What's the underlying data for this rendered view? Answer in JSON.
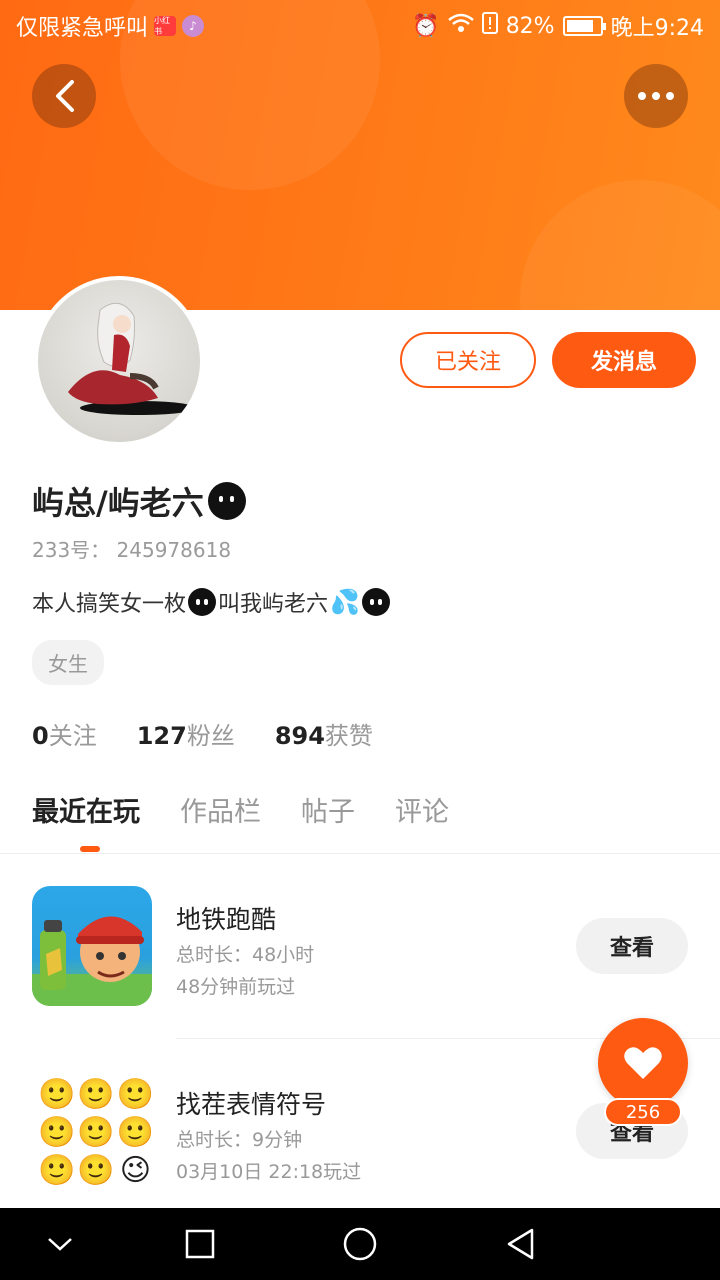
{
  "status_bar": {
    "carrier_text": "仅限紧急呼叫",
    "badge_app": "小红书",
    "battery_percent": "82%",
    "battery_level": 0.82,
    "time": "晚上9:24"
  },
  "header": {
    "back_icon": "chevron-left-icon",
    "more_icon": "more-dots-icon"
  },
  "profile": {
    "follow_button": "已关注",
    "message_button": "发消息",
    "name": "屿总/屿老六",
    "uid": "233号： 245978618",
    "bio_text_1": "本人搞笑女一枚",
    "bio_text_2": "叫我屿老六",
    "gender_tag": "女生",
    "stats": {
      "following_count": "0",
      "following_label": "关注",
      "followers_count": "127",
      "followers_label": "粉丝",
      "likes_count": "894",
      "likes_label": "获赞"
    }
  },
  "tabs": [
    {
      "label": "最近在玩",
      "active": true
    },
    {
      "label": "作品栏"
    },
    {
      "label": "帖子"
    },
    {
      "label": "评论"
    }
  ],
  "games": [
    {
      "title": "地铁跑酷",
      "duration": "总时长：48小时",
      "last_played": "48分钟前玩过",
      "button": "查看"
    },
    {
      "title": "找茬表情符号",
      "duration": "总时长：9分钟",
      "last_played": "03月10日 22:18玩过",
      "button": "查看"
    }
  ],
  "like_fab": {
    "count": "256",
    "icon": "heart-icon"
  },
  "colors": {
    "accent": "#ff5a12",
    "header_gradient_start": "#ff6a13",
    "header_gradient_end": "#ff8a1c"
  }
}
